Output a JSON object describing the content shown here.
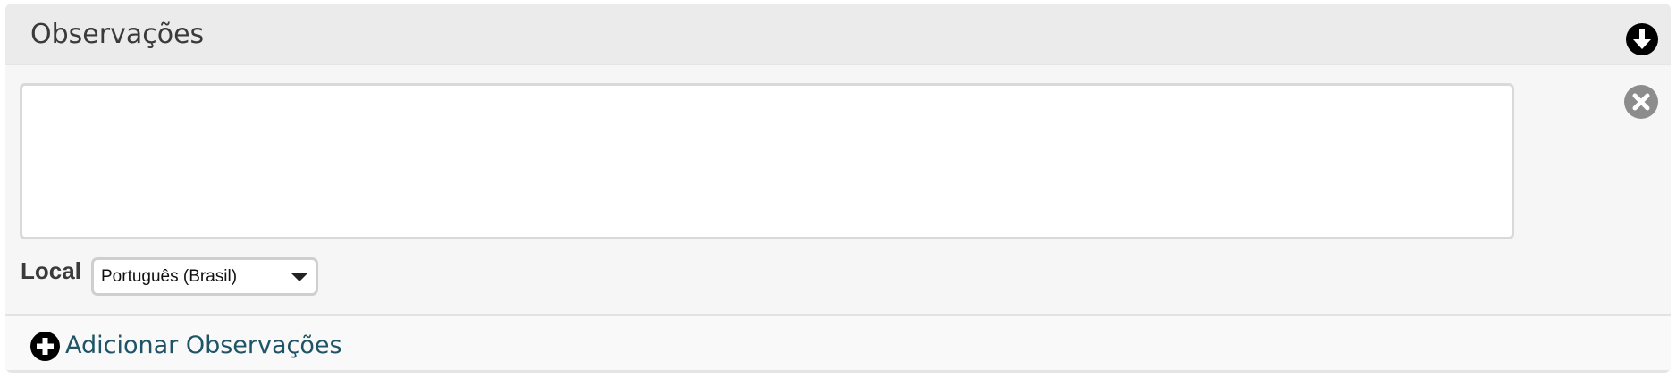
{
  "panel": {
    "title": "Observações",
    "collapse_icon": "arrow-down-circle-icon"
  },
  "observation": {
    "value": "",
    "remove_icon": "close-circle-icon"
  },
  "locale": {
    "label": "Local",
    "selected": "Português (Brasil)"
  },
  "footer": {
    "add_label": "Adicionar Observações",
    "add_icon": "plus-circle-icon"
  },
  "colors": {
    "header_bg": "#ebebeb",
    "body_bg": "#f6f6f6",
    "link_text": "#1e5466",
    "remove_icon": "#8c8c8c"
  }
}
